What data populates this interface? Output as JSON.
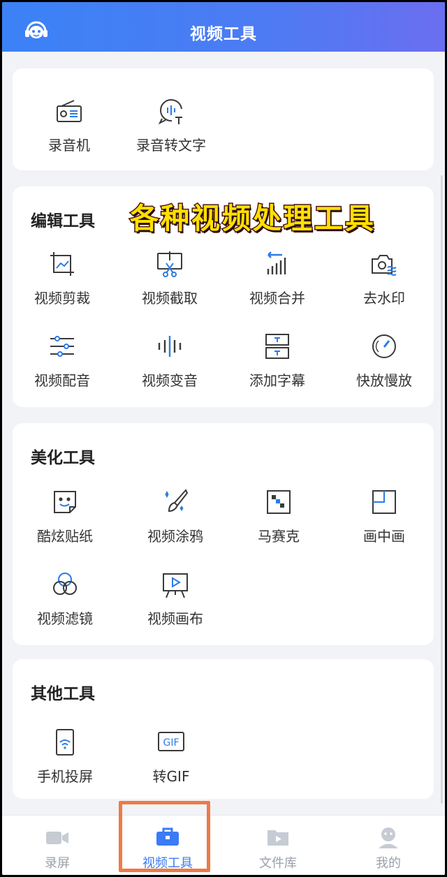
{
  "header": {
    "title": "视频工具",
    "logo_icon": "headset-robot-icon"
  },
  "banner_text": "各种视频处理工具",
  "sections": [
    {
      "title": "",
      "items": [
        {
          "label": "录音机",
          "icon": "radio-icon"
        },
        {
          "label": "录音转文字",
          "icon": "voice-to-text-icon"
        }
      ]
    },
    {
      "title": "编辑工具",
      "items": [
        {
          "label": "视频剪裁",
          "icon": "crop-icon"
        },
        {
          "label": "视频截取",
          "icon": "scissors-screen-icon"
        },
        {
          "label": "视频合并",
          "icon": "merge-bars-icon"
        },
        {
          "label": "去水印",
          "icon": "camera-wave-icon"
        },
        {
          "label": "视频配音",
          "icon": "sliders-icon"
        },
        {
          "label": "视频变音",
          "icon": "sound-wave-icon"
        },
        {
          "label": "添加字幕",
          "icon": "subtitle-icon"
        },
        {
          "label": "快放慢放",
          "icon": "speedometer-icon"
        }
      ]
    },
    {
      "title": "美化工具",
      "items": [
        {
          "label": "酷炫贴纸",
          "icon": "sticker-icon"
        },
        {
          "label": "视频涂鸦",
          "icon": "brush-icon"
        },
        {
          "label": "马赛克",
          "icon": "mosaic-icon"
        },
        {
          "label": "画中画",
          "icon": "picture-in-picture-icon"
        },
        {
          "label": "视频滤镜",
          "icon": "filter-circles-icon"
        },
        {
          "label": "视频画布",
          "icon": "canvas-easel-icon"
        }
      ]
    },
    {
      "title": "其他工具",
      "items": [
        {
          "label": "手机投屏",
          "icon": "phone-cast-icon"
        },
        {
          "label": "转GIF",
          "icon": "gif-icon"
        }
      ]
    }
  ],
  "tabbar": [
    {
      "label": "录屏",
      "icon": "camera-icon",
      "active": false
    },
    {
      "label": "视频工具",
      "icon": "toolbox-icon",
      "active": true
    },
    {
      "label": "文件库",
      "icon": "folder-icon",
      "active": false
    },
    {
      "label": "我的",
      "icon": "user-icon",
      "active": false
    }
  ],
  "colors": {
    "accent": "#3b7bf6",
    "icon_blue": "#2c7be5",
    "highlight": "#ee7a47",
    "banner_fill": "#ffe000"
  }
}
